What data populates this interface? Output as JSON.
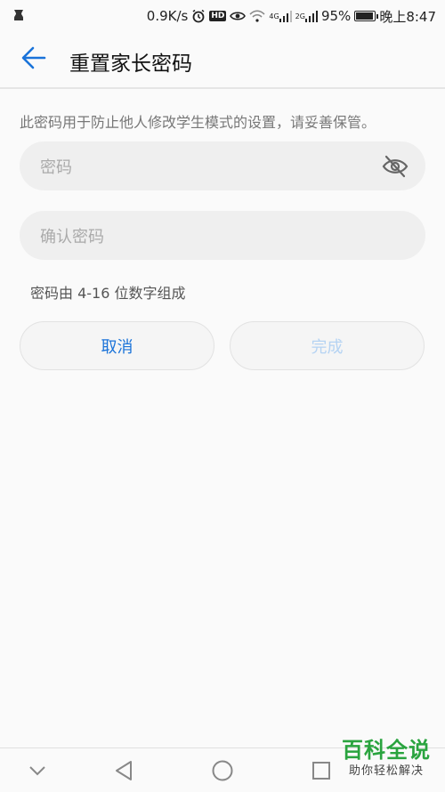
{
  "statusbar": {
    "speed": "0.9K/s",
    "hd": "HD",
    "net4g": "4G",
    "net2g": "2G",
    "battery": "95%",
    "battery_level": 0.95,
    "time": "晚上8:47"
  },
  "appbar": {
    "title": "重置家长密码",
    "back_icon": "arrow-left-icon",
    "accent": "#1a73d9"
  },
  "form": {
    "description": "此密码用于防止他人修改学生模式的设置，请妥善保管。",
    "password_placeholder": "密码",
    "password_toggle_icon": "eye-off-icon",
    "confirm_placeholder": "确认密码",
    "hint": "密码由 4-16 位数字组成"
  },
  "actions": {
    "cancel": "取消",
    "done": "完成"
  },
  "navbar": {
    "icons": [
      "chevron-down-icon",
      "back-triangle-icon",
      "home-circle-icon",
      "recents-square-icon"
    ]
  },
  "watermark": {
    "title": "百科全说",
    "subtitle": "助你轻松解决"
  }
}
